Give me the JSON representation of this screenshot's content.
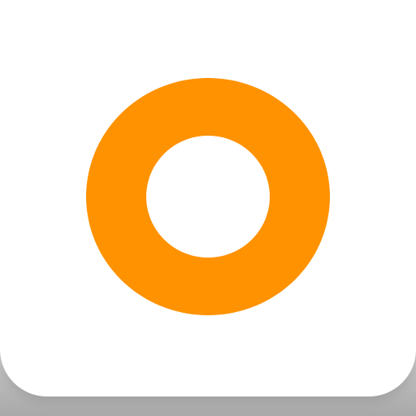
{
  "app_icon": {
    "icon": "orange-ring-icon",
    "background_color": "#ffffff",
    "accent_color": "#ff9200",
    "shadow_color": "#a9a9a9"
  }
}
